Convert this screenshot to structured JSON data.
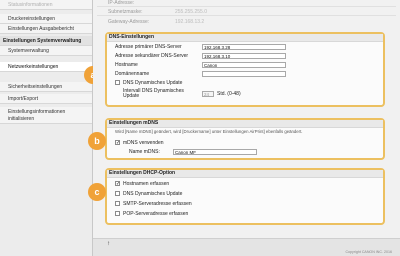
{
  "sidebar": {
    "items": [
      {
        "label": "Statusinformationen",
        "type": "item",
        "faded": true
      },
      {
        "label": "Druckereinstellungen",
        "type": "item"
      },
      {
        "label": "Einstellungen Ausgabebericht",
        "type": "item"
      },
      {
        "label": "Einstellungen Systemverwaltung",
        "type": "head"
      },
      {
        "label": "Systemverwaltung",
        "type": "item"
      },
      {
        "label": "Netzwerkeinstellungen",
        "type": "item",
        "active": true
      },
      {
        "label": "Sicherheitseinstellungen",
        "type": "item"
      },
      {
        "label": "Import/Export",
        "type": "item"
      },
      {
        "label": "Einstellungsinformationen initialisieren",
        "type": "item",
        "tall": true
      }
    ]
  },
  "top": {
    "rows": [
      {
        "label": "IP-Adresse:",
        "value": ""
      },
      {
        "label": "Subnetzmaske:",
        "value": "255.255.255.0"
      },
      {
        "label": "Gateway-Adresse:",
        "value": "192.168.13.2"
      }
    ]
  },
  "dns": {
    "title": "DNS-Einstellungen",
    "primary_label": "Adresse primärer DNS-Server",
    "primary_value": "192.168.3.28",
    "secondary_label": "Adresse sekundärer DNS-Server",
    "secondary_value": "192.168.3.10",
    "hostname_label": "Hostname",
    "hostname_value": "Canon",
    "domain_label": "Domänenname",
    "domain_value": "",
    "dyn_label": "DNS Dynamisches Update",
    "dyn_checked": false,
    "interval_label_1": "Intervall DNS Dynamisches",
    "interval_label_2": "Update",
    "interval_value": "24",
    "interval_unit": "Std. (0-48)",
    "badge": "a"
  },
  "mdns": {
    "title": "Einstellungen mDNS",
    "note": "Wird [Name mDNS] geändert, wird [Druckername] unter Einstellungen AirPrint] ebenfalls geändert.",
    "use_label": "mDNS verwenden",
    "use_checked": true,
    "name_label": "Name mDNS:",
    "name_value": "Canon MF",
    "badge": "b"
  },
  "dhcp": {
    "title": "Einstellungen DHCP-Option",
    "options": [
      {
        "label": "Hostnamen erfassen",
        "checked": true
      },
      {
        "label": "DNS Dynamisches Update",
        "checked": false
      },
      {
        "label": "SMTP-Serveradresse erfassen",
        "checked": false
      },
      {
        "label": "POP-Serveradresse erfassen",
        "checked": false
      }
    ],
    "badge": "c"
  },
  "footer": {
    "scroll_top": "↑",
    "copyright": "Copyright CANON INC. 2016"
  }
}
